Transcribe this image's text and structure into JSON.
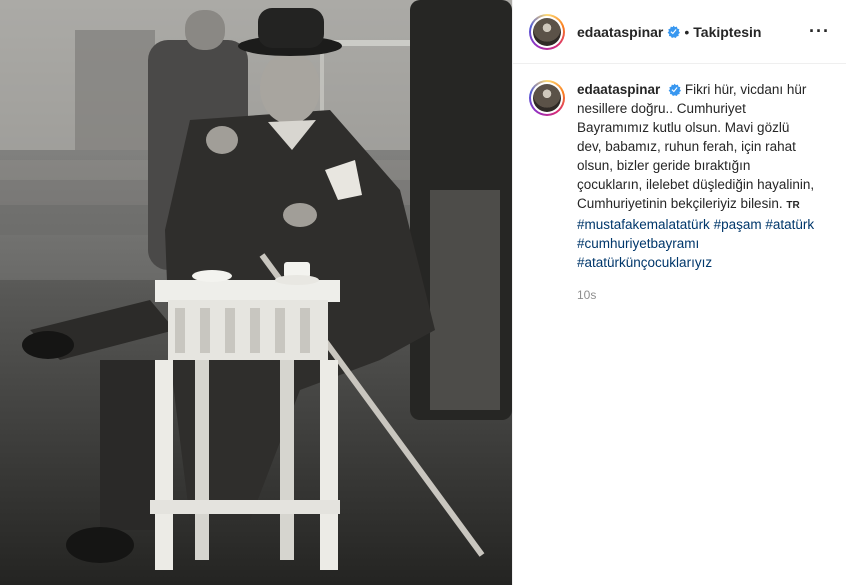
{
  "post": {
    "username": "edaataspinar",
    "dot": "•",
    "follow_status": "Takiptesin",
    "more_icon": "···",
    "caption": "Fikri hür, vicdanı hür nesillere doğru.. Cumhuriyet Bayramımız kutlu olsun. Mavi gözlü dev, babamız, ruhun ferah, için rahat olsun, bizler geride bıraktığın çocukların, ilelebet düşlediğin hayalinin, Cumhuriyetinin bekçileriyiz bilesin.",
    "language_tag": "TR",
    "hashtags": [
      "#mustafakemalatatürk",
      "#paşam",
      "#atatürk",
      "#cumhuriyetbayramı",
      "#atatürkünçocuklarıyız"
    ],
    "time": "10s"
  },
  "colors": {
    "verified": "#3897f0",
    "link": "#00376b",
    "muted": "#8e8e8e"
  },
  "icons": {
    "verified": "verified-badge-icon",
    "more": "more-options-icon"
  }
}
